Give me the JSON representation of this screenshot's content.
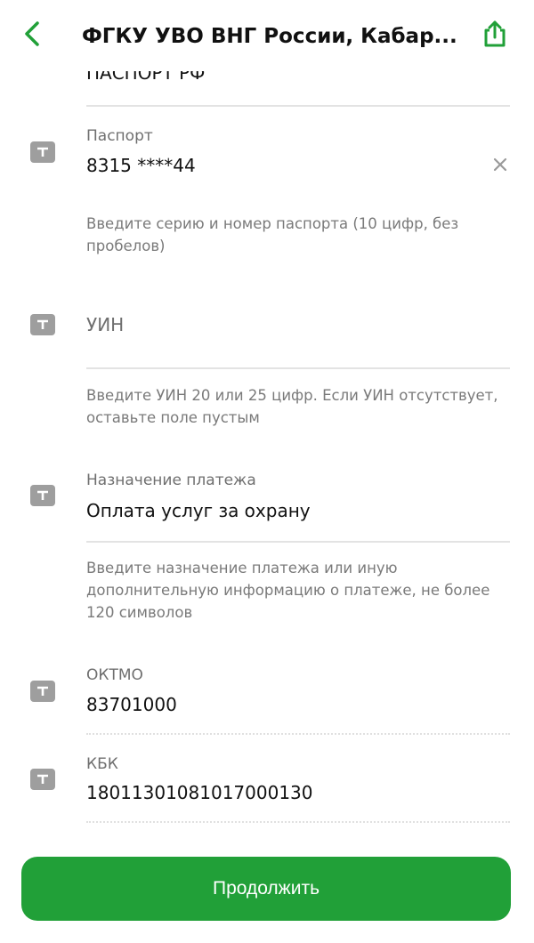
{
  "header": {
    "title": "ФГКУ УВО ВНГ России, Кабар...",
    "back_icon": "chevron-left-icon",
    "share_icon": "share-icon",
    "accent_color": "#21a038"
  },
  "document_type": {
    "value": "ПАСПОРТ РФ"
  },
  "passport": {
    "label": "Паспорт",
    "value": "8315 ****44",
    "hint": "Введите серию и номер паспорта (10 цифр, без пробелов)"
  },
  "uin": {
    "placeholder": "УИН",
    "hint": "Введите УИН 20 или 25 цифр. Если УИН отсутствует, оставьте поле пустым"
  },
  "purpose": {
    "label": "Назначение платежа",
    "value": "Оплата услуг за охрану",
    "hint": "Введите назначение платежа или иную дополнительную информацию о платеже, не более 120 символов"
  },
  "oktmo": {
    "label": "ОКТМО",
    "value": "83701000"
  },
  "kbk": {
    "label": "КБК",
    "value": "18011301081017000130"
  },
  "actions": {
    "continue_label": "Продолжить",
    "button_color": "#21a038"
  }
}
